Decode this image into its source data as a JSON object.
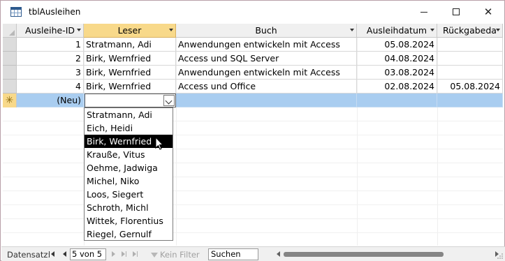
{
  "window": {
    "title": "tblAusleihen"
  },
  "columns": [
    {
      "label": "Ausleihe-ID"
    },
    {
      "label": "Leser"
    },
    {
      "label": "Buch"
    },
    {
      "label": "Ausleihdatum"
    },
    {
      "label": "Rückgabeda"
    }
  ],
  "rows": [
    {
      "id": "1",
      "leser": "Stratmann, Adi",
      "buch": "Anwendungen entwickeln mit Access",
      "ausleihdatum": "05.08.2024",
      "rueckgabe": ""
    },
    {
      "id": "2",
      "leser": "Birk, Wernfried",
      "buch": "Access und SQL Server",
      "ausleihdatum": "04.08.2024",
      "rueckgabe": ""
    },
    {
      "id": "3",
      "leser": "Birk, Wernfried",
      "buch": "Anwendungen entwickeln mit Access",
      "ausleihdatum": "03.08.2024",
      "rueckgabe": ""
    },
    {
      "id": "4",
      "leser": "Birk, Wernfried",
      "buch": "Access und Office",
      "ausleihdatum": "02.08.2024",
      "rueckgabe": "05.08.2024"
    }
  ],
  "new_row": {
    "marker": "✳",
    "id": "(Neu)",
    "leser": ""
  },
  "dropdown": {
    "items": [
      "Stratmann, Adi",
      "Eich, Heidi",
      "Birk, Wernfried",
      "Krauße, Vitus",
      "Oehme, Jadwiga",
      "Michel, Niko",
      "Loos, Siegert",
      "Schroth, Michl",
      "Wittek, Florentius",
      "Riegel, Gernulf"
    ],
    "highlighted_index": 2
  },
  "statusbar": {
    "label": "Datensatz:",
    "record": "5 von 5",
    "filter": "Kein Filter",
    "search": "Suchen"
  },
  "colors": {
    "header_selected": "#f8d98a",
    "new_row": "#a9cdf0",
    "highlight": "#000000"
  }
}
